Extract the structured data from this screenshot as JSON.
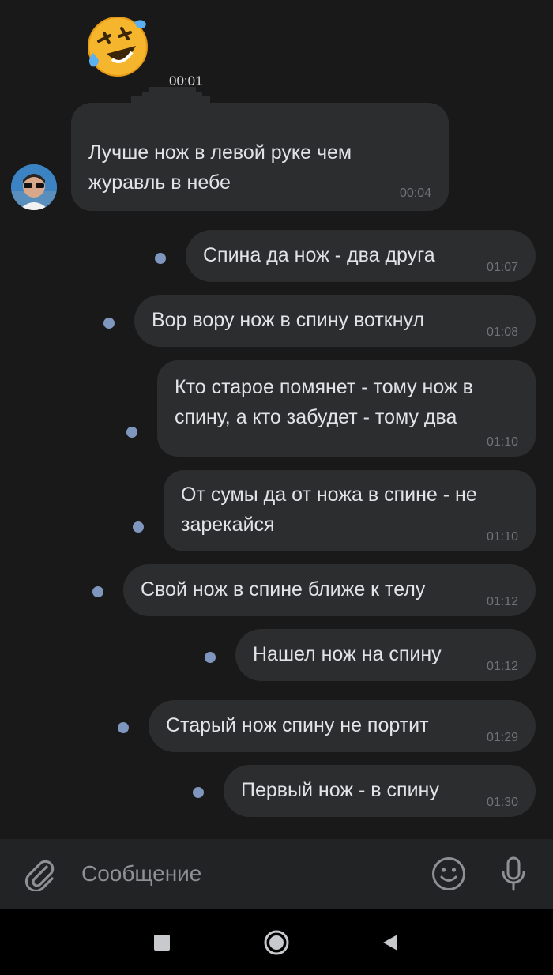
{
  "voice_message": {
    "duration": "00:01"
  },
  "incoming": {
    "text": "Лучше нож в левой руке чем журавль в небе",
    "time": "00:04"
  },
  "outgoing": [
    {
      "text": "Спина да нож - два друга",
      "time": "01:07"
    },
    {
      "text": "Вор вору нож в спину воткнул",
      "time": "01:08"
    },
    {
      "text": "Кто старое помянет - тому нож в спину, а кто забудет - тому два",
      "time": "01:10"
    },
    {
      "text": "От сумы да от ножа в спине - не зарекайся",
      "time": "01:10"
    },
    {
      "text": "Свой нож в спине ближе к телу",
      "time": "01:12"
    },
    {
      "text": "Нашел нож на спину",
      "time": "01:12"
    },
    {
      "text": "Старый нож спину не портит",
      "time": "01:29"
    },
    {
      "text": "Первый нож - в спину",
      "time": "01:30"
    }
  ],
  "composer": {
    "placeholder": "Сообщение"
  },
  "colors": {
    "background": "#19191a",
    "bubble": "#2c2d2f",
    "unread_dot": "#7f96bf",
    "text": "#e1e3e6",
    "time": "#6f7377"
  },
  "icons": [
    "laughing-emoji-icon",
    "avatar",
    "paperclip-icon",
    "smile-icon",
    "microphone-icon",
    "square-nav-icon",
    "circle-home-icon",
    "triangle-back-icon"
  ]
}
